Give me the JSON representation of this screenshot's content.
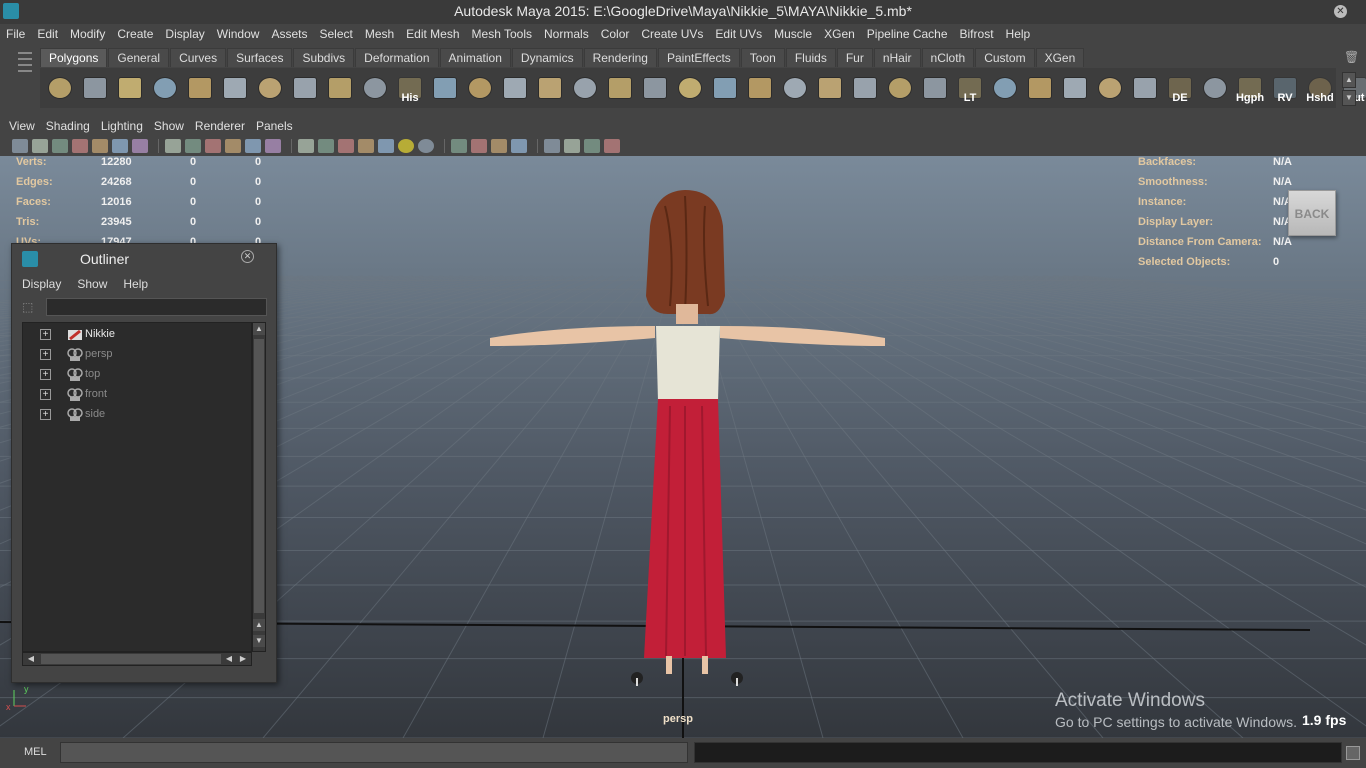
{
  "window": {
    "title": "Autodesk Maya 2015: E:\\GoogleDrive\\Maya\\Nikkie_5\\MAYA\\Nikkie_5.mb*"
  },
  "main_menu": [
    "File",
    "Edit",
    "Modify",
    "Create",
    "Display",
    "Window",
    "Assets",
    "Select",
    "Mesh",
    "Edit Mesh",
    "Mesh Tools",
    "Normals",
    "Color",
    "Create UVs",
    "Edit UVs",
    "Muscle",
    "XGen",
    "Pipeline Cache",
    "Bifrost",
    "Help"
  ],
  "shelf": {
    "tabs": [
      "Polygons",
      "General",
      "Curves",
      "Surfaces",
      "Subdivs",
      "Deformation",
      "Animation",
      "Dynamics",
      "Rendering",
      "PaintEffects",
      "Toon",
      "Fluids",
      "Fur",
      "nHair",
      "nCloth",
      "Custom",
      "XGen"
    ],
    "active_tab": "Polygons",
    "icons": [
      {
        "name": "poly-sphere-icon",
        "label": ""
      },
      {
        "name": "poly-cube-icon",
        "label": ""
      },
      {
        "name": "poly-cylinder-icon",
        "label": ""
      },
      {
        "name": "poly-cone-icon",
        "label": ""
      },
      {
        "name": "poly-plane-icon",
        "label": ""
      },
      {
        "name": "poly-torus-icon",
        "label": ""
      },
      {
        "name": "poly-pyramid-icon",
        "label": ""
      },
      {
        "name": "poly-pipe-icon",
        "label": ""
      },
      {
        "name": "poly-helix-icon",
        "label": ""
      },
      {
        "name": "poly-soccerball-icon",
        "label": ""
      },
      {
        "name": "history-icon",
        "label": "His"
      },
      {
        "name": "combine-icon",
        "label": ""
      },
      {
        "name": "separate-icon",
        "label": ""
      },
      {
        "name": "extract-icon",
        "label": ""
      },
      {
        "name": "extrude-icon",
        "label": ""
      },
      {
        "name": "bridge-icon",
        "label": ""
      },
      {
        "name": "append-icon",
        "label": ""
      },
      {
        "name": "merge-icon",
        "label": ""
      },
      {
        "name": "split-icon",
        "label": ""
      },
      {
        "name": "insert-edge-loop-icon",
        "label": ""
      },
      {
        "name": "offset-edge-loop-icon",
        "label": ""
      },
      {
        "name": "sculpt-icon",
        "label": ""
      },
      {
        "name": "paint-tool-icon",
        "label": ""
      },
      {
        "name": "target-weld-icon",
        "label": ""
      },
      {
        "name": "soft-select-icon",
        "label": ""
      },
      {
        "name": "transfer-icon",
        "label": ""
      },
      {
        "name": "lattice-tool-icon",
        "label": "LT"
      },
      {
        "name": "uv-planar-icon",
        "label": ""
      },
      {
        "name": "uv-cylindrical-icon",
        "label": ""
      },
      {
        "name": "uv-spherical-icon",
        "label": ""
      },
      {
        "name": "uv-automatic-icon",
        "label": ""
      },
      {
        "name": "uv-editor-icon",
        "label": ""
      },
      {
        "name": "display-edges-icon",
        "label": "DE"
      },
      {
        "name": "uv-layout-icon",
        "label": ""
      },
      {
        "name": "hypergraph-icon",
        "label": "Hgph"
      },
      {
        "name": "render-view-icon",
        "label": "RV"
      },
      {
        "name": "hypershade-icon",
        "label": "Hshd"
      },
      {
        "name": "outliner-icon",
        "label": "Out"
      }
    ]
  },
  "panel_menu": [
    "View",
    "Shading",
    "Lighting",
    "Show",
    "Renderer",
    "Panels"
  ],
  "hud_left": [
    {
      "label": "Verts:",
      "v1": "12280",
      "v2": "0",
      "v3": "0"
    },
    {
      "label": "Edges:",
      "v1": "24268",
      "v2": "0",
      "v3": "0"
    },
    {
      "label": "Faces:",
      "v1": "12016",
      "v2": "0",
      "v3": "0"
    },
    {
      "label": "Tris:",
      "v1": "23945",
      "v2": "0",
      "v3": "0"
    },
    {
      "label": "UVs:",
      "v1": "17947",
      "v2": "0",
      "v3": "0"
    }
  ],
  "hud_right": [
    {
      "label": "Backfaces:",
      "value": "N/A"
    },
    {
      "label": "Smoothness:",
      "value": "N/A"
    },
    {
      "label": "Instance:",
      "value": "N/A"
    },
    {
      "label": "Display Layer:",
      "value": "N/A"
    },
    {
      "label": "Distance From Camera:",
      "value": "N/A"
    },
    {
      "label": "Selected Objects:",
      "value": "0"
    }
  ],
  "viewcube_label": "BACK",
  "camera_name": "persp",
  "fps": "1.9 fps",
  "watermark": {
    "line1": "Activate Windows",
    "line2": "Go to PC settings to activate Windows."
  },
  "outliner": {
    "title": "Outliner",
    "menu": [
      "Display",
      "Show",
      "Help"
    ],
    "filter_value": "",
    "items": [
      {
        "label": "Nikkie",
        "dim": false
      },
      {
        "label": "persp",
        "dim": true
      },
      {
        "label": "top",
        "dim": true
      },
      {
        "label": "front",
        "dim": true
      },
      {
        "label": "side",
        "dim": true
      }
    ]
  },
  "command_line": {
    "label": "MEL",
    "value": ""
  },
  "axis": {
    "x": "x",
    "y": "y"
  },
  "colors": {
    "hud_label": "#e2c8a0",
    "shirt": "#e6e4d6",
    "skirt": "#c21f38",
    "hair": "#7a3a22",
    "skin": "#e8c4a6"
  }
}
